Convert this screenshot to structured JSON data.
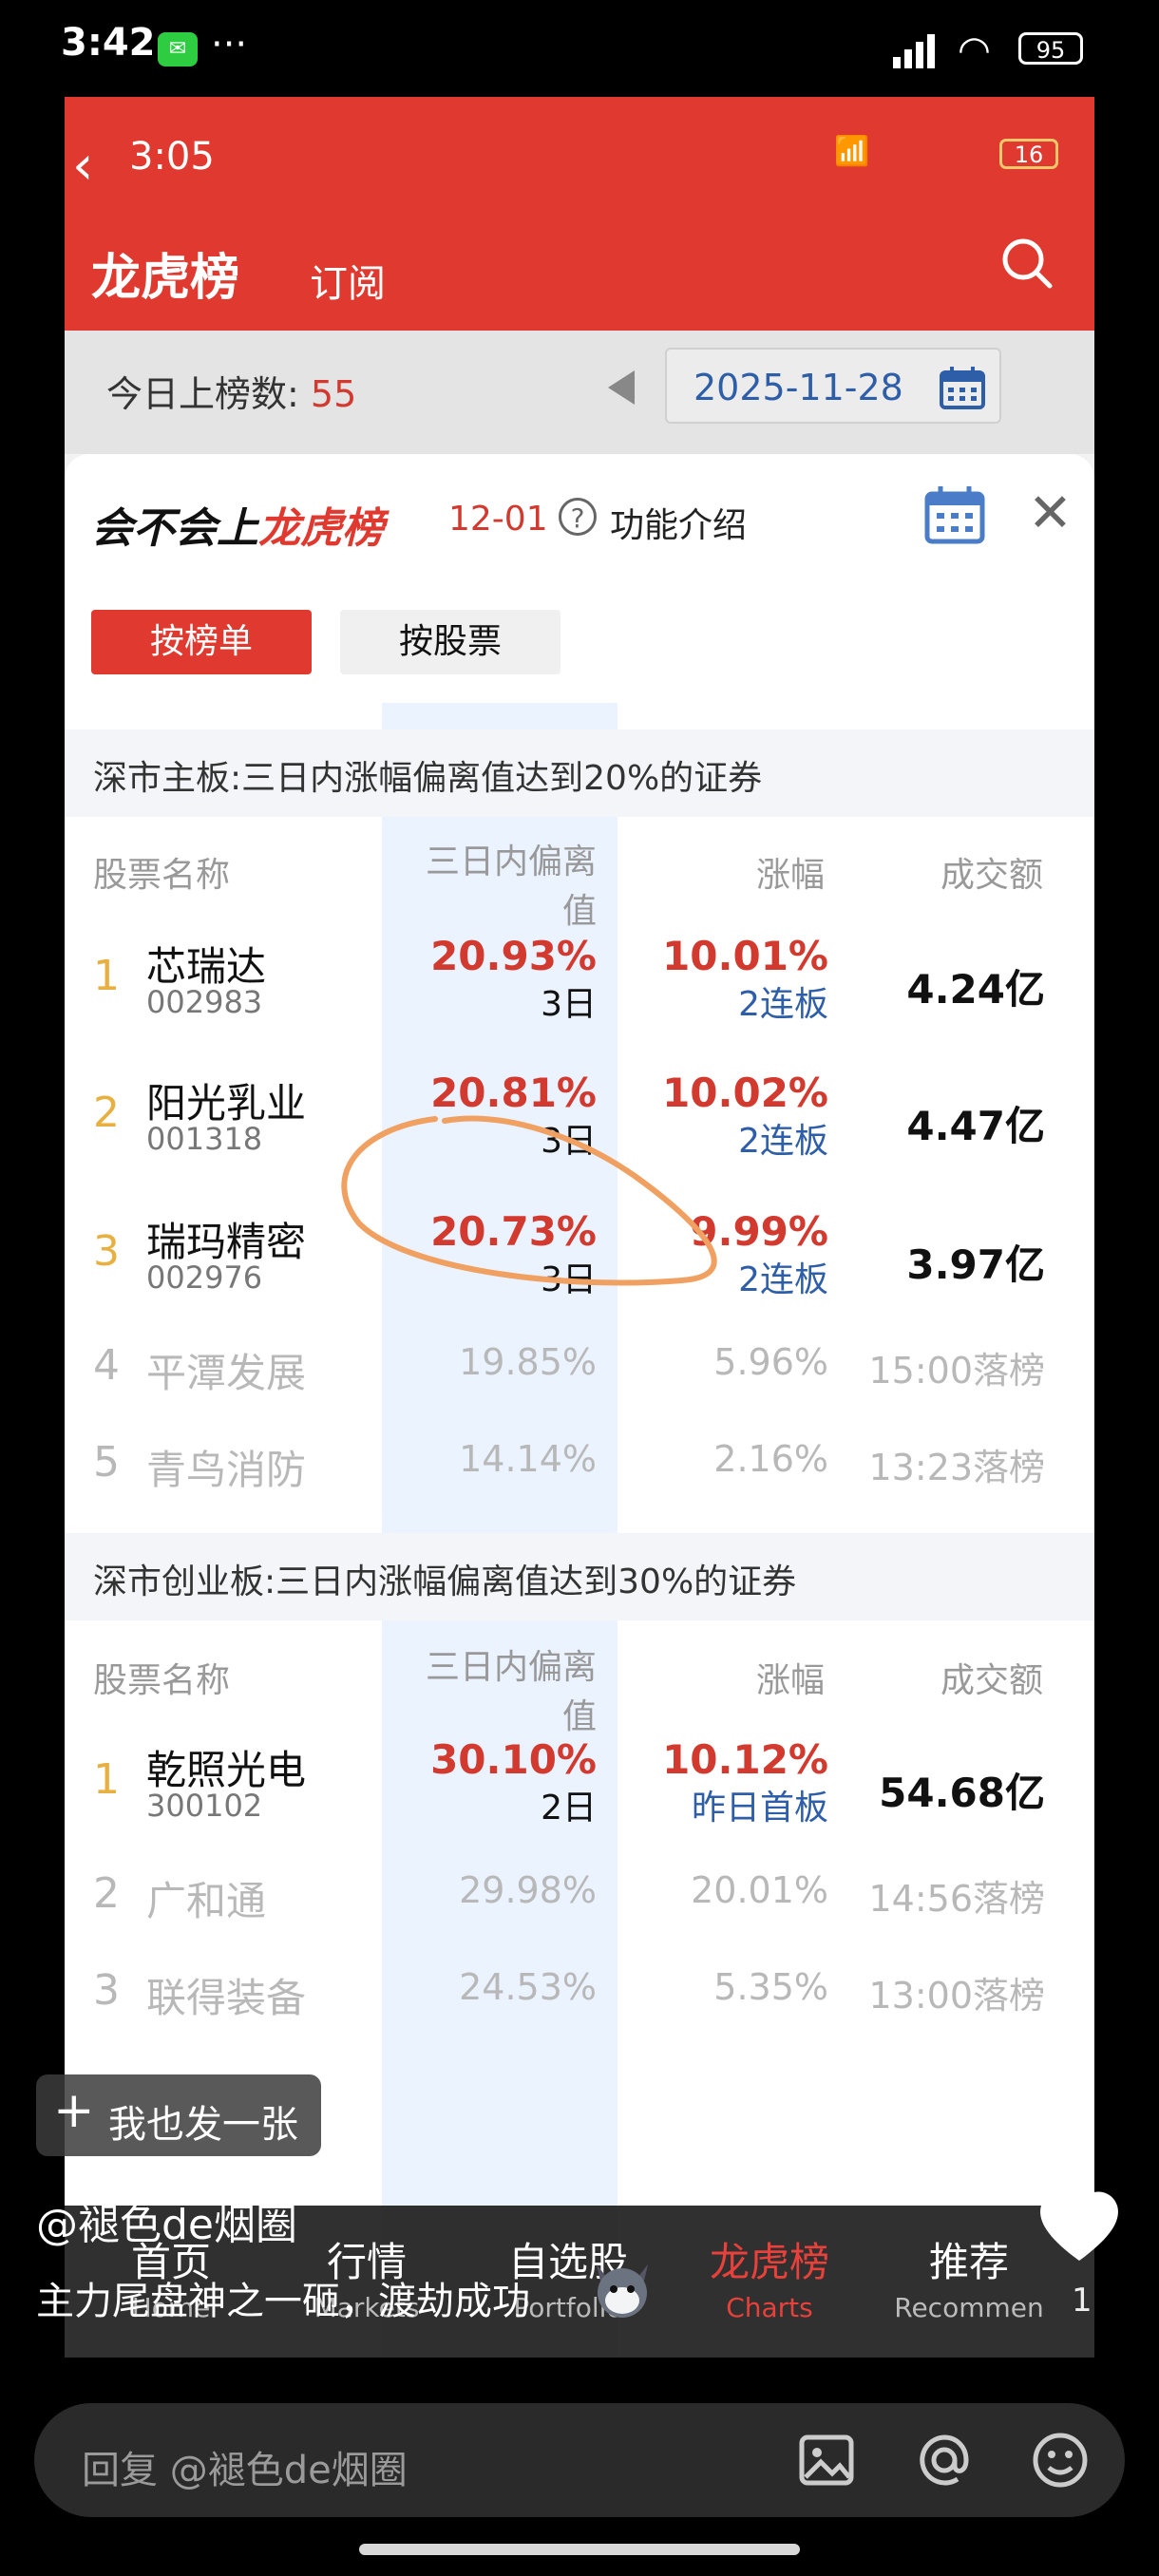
{
  "phone_status": {
    "time": "3:42",
    "battery": "95",
    "more": "···"
  },
  "app_status": {
    "time": "3:05",
    "battery": "16"
  },
  "app_header": {
    "title": "龙虎榜",
    "subtitle": "订阅"
  },
  "count_bar": {
    "label": "今日上榜数: ",
    "count": "55",
    "date": "2025-11-28"
  },
  "panel": {
    "title_a": "会不会上",
    "title_b": "龙虎榜",
    "date": "12-01",
    "help_glyph": "?",
    "intro": "功能介绍",
    "tabs": [
      "按榜单",
      "按股票"
    ]
  },
  "columns": {
    "name": "股票名称",
    "dev_line1": "三日内偏离",
    "dev_line2": "值",
    "chg": "涨幅",
    "amount": "成交额"
  },
  "sections": [
    {
      "title": "深市主板:三日内涨幅偏离值达到20%的证券",
      "rows": [
        {
          "rank": "1",
          "name": "芯瑞达",
          "code": "002983",
          "dev": "20.93%",
          "days": "3日",
          "chg": "10.01%",
          "board": "2连板",
          "amount": "4.24亿"
        },
        {
          "rank": "2",
          "name": "阳光乳业",
          "code": "001318",
          "dev": "20.81%",
          "days": "3日",
          "chg": "10.02%",
          "board": "2连板",
          "amount": "4.47亿"
        },
        {
          "rank": "3",
          "name": "瑞玛精密",
          "code": "002976",
          "dev": "20.73%",
          "days": "3日",
          "chg": "9.99%",
          "board": "2连板",
          "amount": "3.97亿"
        },
        {
          "rank": "4",
          "name": "平潭发展",
          "dev": "19.85%",
          "chg": "5.96%",
          "amount": "15:00落榜"
        },
        {
          "rank": "5",
          "name": "青鸟消防",
          "dev": "14.14%",
          "chg": "2.16%",
          "amount": "13:23落榜"
        }
      ]
    },
    {
      "title": "深市创业板:三日内涨幅偏离值达到30%的证券",
      "rows": [
        {
          "rank": "1",
          "name": "乾照光电",
          "code": "300102",
          "dev": "30.10%",
          "days": "2日",
          "chg": "10.12%",
          "board": "昨日首板",
          "amount": "54.68亿"
        },
        {
          "rank": "2",
          "name": "广和通",
          "dev": "29.98%",
          "chg": "20.01%",
          "amount": "14:56落榜"
        },
        {
          "rank": "3",
          "name": "联得装备",
          "dev": "24.53%",
          "chg": "5.35%",
          "amount": "13:00落榜"
        }
      ]
    }
  ],
  "tabbar": [
    {
      "cn": "首页",
      "en": "Home"
    },
    {
      "cn": "行情",
      "en": "Markets"
    },
    {
      "cn": "自选股",
      "en": "Portfolio"
    },
    {
      "cn": "龙虎榜",
      "en": "Charts"
    },
    {
      "cn": "推荐",
      "en": "Recommen"
    }
  ],
  "overlay": {
    "chip_plus": "+",
    "chip": "我也发一张",
    "author": "@褪色de烟圈",
    "caption": "主力尾盘神之一砸，渡劫成功",
    "likes": "1",
    "reply_placeholder": "回复 @褪色de烟圈"
  },
  "colors": {
    "accent_red": "#e03a30",
    "blue": "#2f5ea8",
    "highlight": "#eaf3ff",
    "annotation_orange": "#f0a060"
  }
}
